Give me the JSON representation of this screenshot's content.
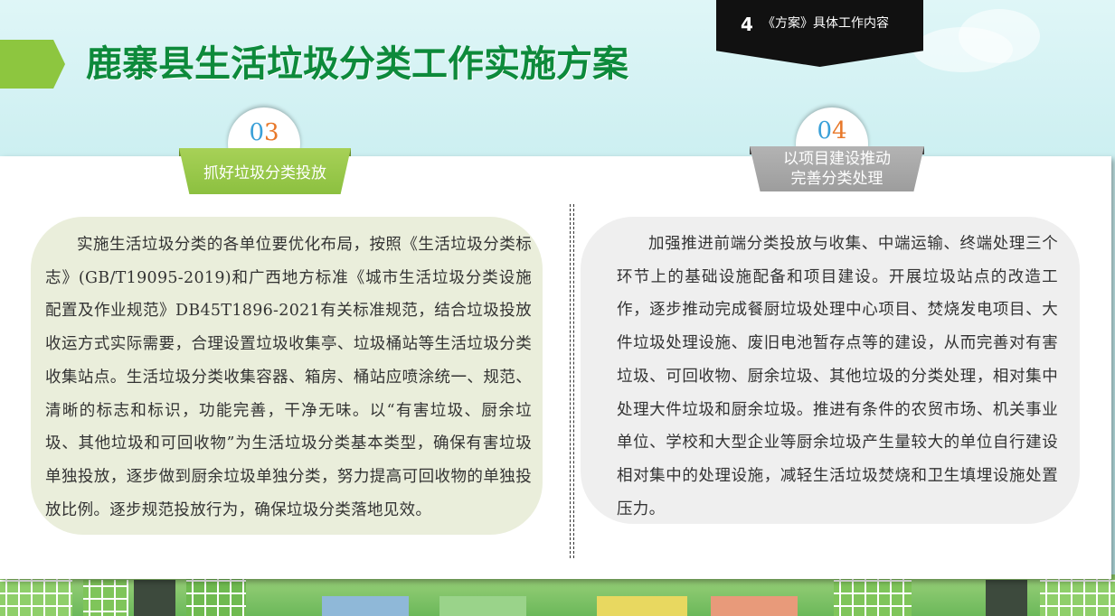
{
  "header": {
    "title": "鹿寨县生活垃圾分类工作实施方案",
    "section_number": "4",
    "section_label": "《方案》具体工作内容"
  },
  "sections": [
    {
      "number_d1": "0",
      "number_d2": "3",
      "heading": "抓好垃圾分类投放",
      "body": "实施生活垃圾分类的各单位要优化布局，按照《生活垃圾分类标志》(GB/T19095-2019)和广西地方标准《城市生活垃圾分类设施配置及作业规范》DB45T1896-2021有关标准规范，结合垃圾投放收运方式实际需要，合理设置垃圾收集亭、垃圾桶站等生活垃圾分类收集站点。生活垃圾分类收集容器、箱房、桶站应喷涂统一、规范、清晰的标志和标识，功能完善，干净无味。以“有害垃圾、厨余垃圾、其他垃圾和可回收物”为生活垃圾分类基本类型，确保有害垃圾单独投放，逐步做到厨余垃圾单独分类，努力提高可回收物的单独投放比例。逐步规范投放行为，确保垃圾分类落地见效。"
    },
    {
      "number_d1": "0",
      "number_d2": "4",
      "heading_line1": "以项目建设推动",
      "heading_line2": "完善分类处理",
      "body": "加强推进前端分类投放与收集、中端运输、终端处理三个环节上的基础设施配备和项目建设。开展垃圾站点的改造工作，逐步推动完成餐厨垃圾处理中心项目、焚烧发电项目、大件垃圾处理设施、废旧电池暂存点等的建设，从而完善对有害垃圾、可回收物、厨余垃圾、其他垃圾的分类处理，相对集中处理大件垃圾和厨余垃圾。推进有条件的农贸市场、机关事业单位、学校和大型企业等厨余垃圾产生量较大的单位自行建设相对集中的处理设施，减轻生活垃圾焚烧和卫生填埋设施处置压力。"
    }
  ],
  "colors": {
    "title_green": "#0d8a3b",
    "ribbon_green": "#8cc040",
    "ribbon_gray": "#9d9d9d",
    "digit_blue": "#3aa0d8",
    "digit_orange": "#e8782a"
  }
}
